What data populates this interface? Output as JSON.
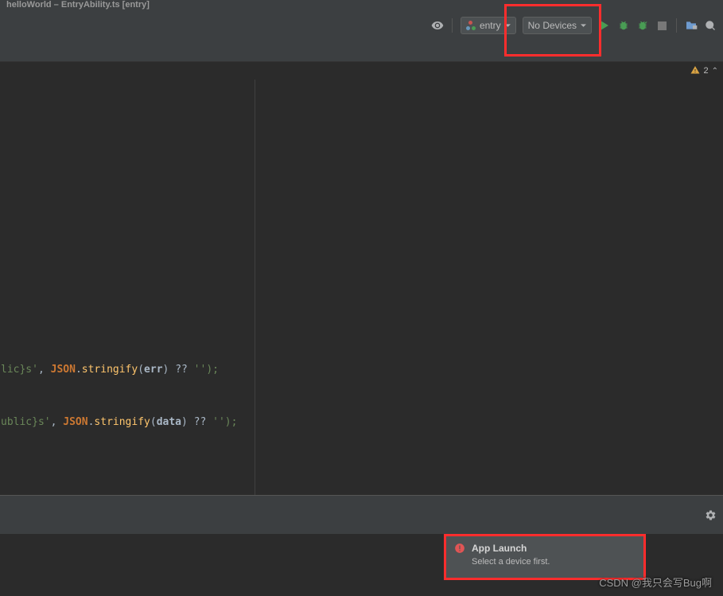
{
  "titlebar": {
    "title": "helloWorld – EntryAbility.ts [entry]"
  },
  "toolbar": {
    "entry_dropdown": "entry",
    "devices_dropdown": "No Devices"
  },
  "notifications": {
    "warn_count": "2"
  },
  "code": {
    "line1_str": "lic}s'",
    "line1_comma": ", ",
    "line1_json": "JSON",
    "line1_dot": ".",
    "line1_method": "stringify",
    "line1_open": "(",
    "line1_param": "err",
    "line1_close": ") ",
    "line1_op": "??",
    "line1_end": " '');",
    "line2_str": "ublic}s'",
    "line2_comma": ", ",
    "line2_json": "JSON",
    "line2_dot": ".",
    "line2_method": "stringify",
    "line2_open": "(",
    "line2_param": "data",
    "line2_close": ") ",
    "line2_op": "??",
    "line2_end": " '');"
  },
  "popup": {
    "title": "App Launch",
    "message": "Select a device first."
  },
  "watermark": "CSDN @我只会写Bug啊"
}
